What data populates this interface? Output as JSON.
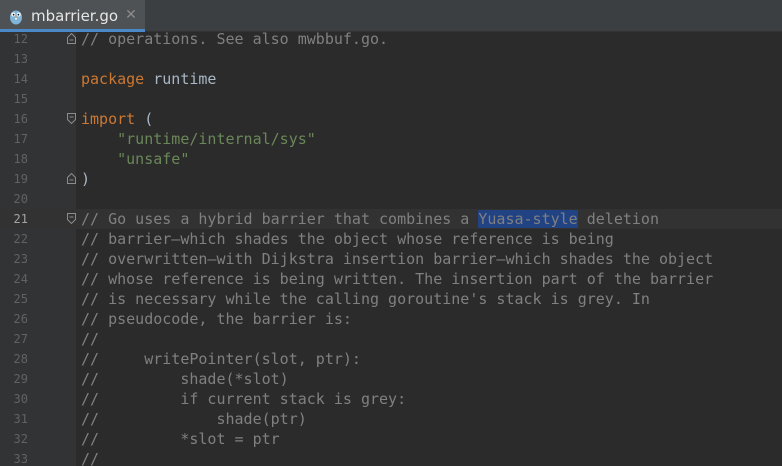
{
  "tab": {
    "label": "mbarrier.go",
    "close_glyph": "✕",
    "icon": "go-gopher-icon"
  },
  "colors": {
    "background": "#2b2b2b",
    "gutter": "#313335",
    "keyword": "#cc7832",
    "string": "#6a8759",
    "comment": "#808080",
    "identifier": "#a9b7c6",
    "selection": "#214283",
    "tab_accent": "#4a88c7"
  },
  "editor": {
    "current_line": "21",
    "lines": [
      {
        "num": "12",
        "parts": [
          {
            "t": "// operations. See also mwbbuf.go.",
            "c": "cm"
          }
        ],
        "fold": "end"
      },
      {
        "num": "13",
        "parts": []
      },
      {
        "num": "14",
        "parts": [
          {
            "t": "package",
            "c": "kw"
          },
          {
            "t": " runtime",
            "c": "ident"
          }
        ]
      },
      {
        "num": "15",
        "parts": []
      },
      {
        "num": "16",
        "parts": [
          {
            "t": "import",
            "c": "kw"
          },
          {
            "t": " (",
            "c": "ident"
          }
        ],
        "fold": "start"
      },
      {
        "num": "17",
        "parts": [
          {
            "t": "    ",
            "c": "ident"
          },
          {
            "t": "\"runtime/internal/sys\"",
            "c": "str"
          }
        ]
      },
      {
        "num": "18",
        "parts": [
          {
            "t": "    ",
            "c": "ident"
          },
          {
            "t": "\"unsafe\"",
            "c": "str"
          }
        ]
      },
      {
        "num": "19",
        "parts": [
          {
            "t": ")",
            "c": "ident"
          }
        ],
        "fold": "end"
      },
      {
        "num": "20",
        "parts": []
      },
      {
        "num": "21",
        "parts": [
          {
            "t": "// Go uses a hybrid barrier that combines a ",
            "c": "cm"
          },
          {
            "t": "Yuasa-style",
            "c": "hl"
          },
          {
            "t": " deletion",
            "c": "cm"
          }
        ],
        "fold": "start"
      },
      {
        "num": "22",
        "parts": [
          {
            "t": "// barrier—which shades the object whose reference is being",
            "c": "cm"
          }
        ]
      },
      {
        "num": "23",
        "parts": [
          {
            "t": "// overwritten—with Dijkstra insertion barrier—which shades the object",
            "c": "cm"
          }
        ]
      },
      {
        "num": "24",
        "parts": [
          {
            "t": "// whose reference is being written. The insertion part of the barrier",
            "c": "cm"
          }
        ]
      },
      {
        "num": "25",
        "parts": [
          {
            "t": "// is necessary while the calling goroutine's stack is grey. In",
            "c": "cm"
          }
        ]
      },
      {
        "num": "26",
        "parts": [
          {
            "t": "// pseudocode, the barrier is:",
            "c": "cm"
          }
        ]
      },
      {
        "num": "27",
        "parts": [
          {
            "t": "//",
            "c": "cm"
          }
        ]
      },
      {
        "num": "28",
        "parts": [
          {
            "t": "//     writePointer(slot, ptr):",
            "c": "cm"
          }
        ]
      },
      {
        "num": "29",
        "parts": [
          {
            "t": "//         shade(*slot)",
            "c": "cm"
          }
        ]
      },
      {
        "num": "30",
        "parts": [
          {
            "t": "//         if current stack is grey:",
            "c": "cm"
          }
        ]
      },
      {
        "num": "31",
        "parts": [
          {
            "t": "//             shade(ptr)",
            "c": "cm"
          }
        ]
      },
      {
        "num": "32",
        "parts": [
          {
            "t": "//         *slot = ptr",
            "c": "cm"
          }
        ]
      },
      {
        "num": "33",
        "parts": [
          {
            "t": "//",
            "c": "cm"
          }
        ]
      }
    ]
  }
}
